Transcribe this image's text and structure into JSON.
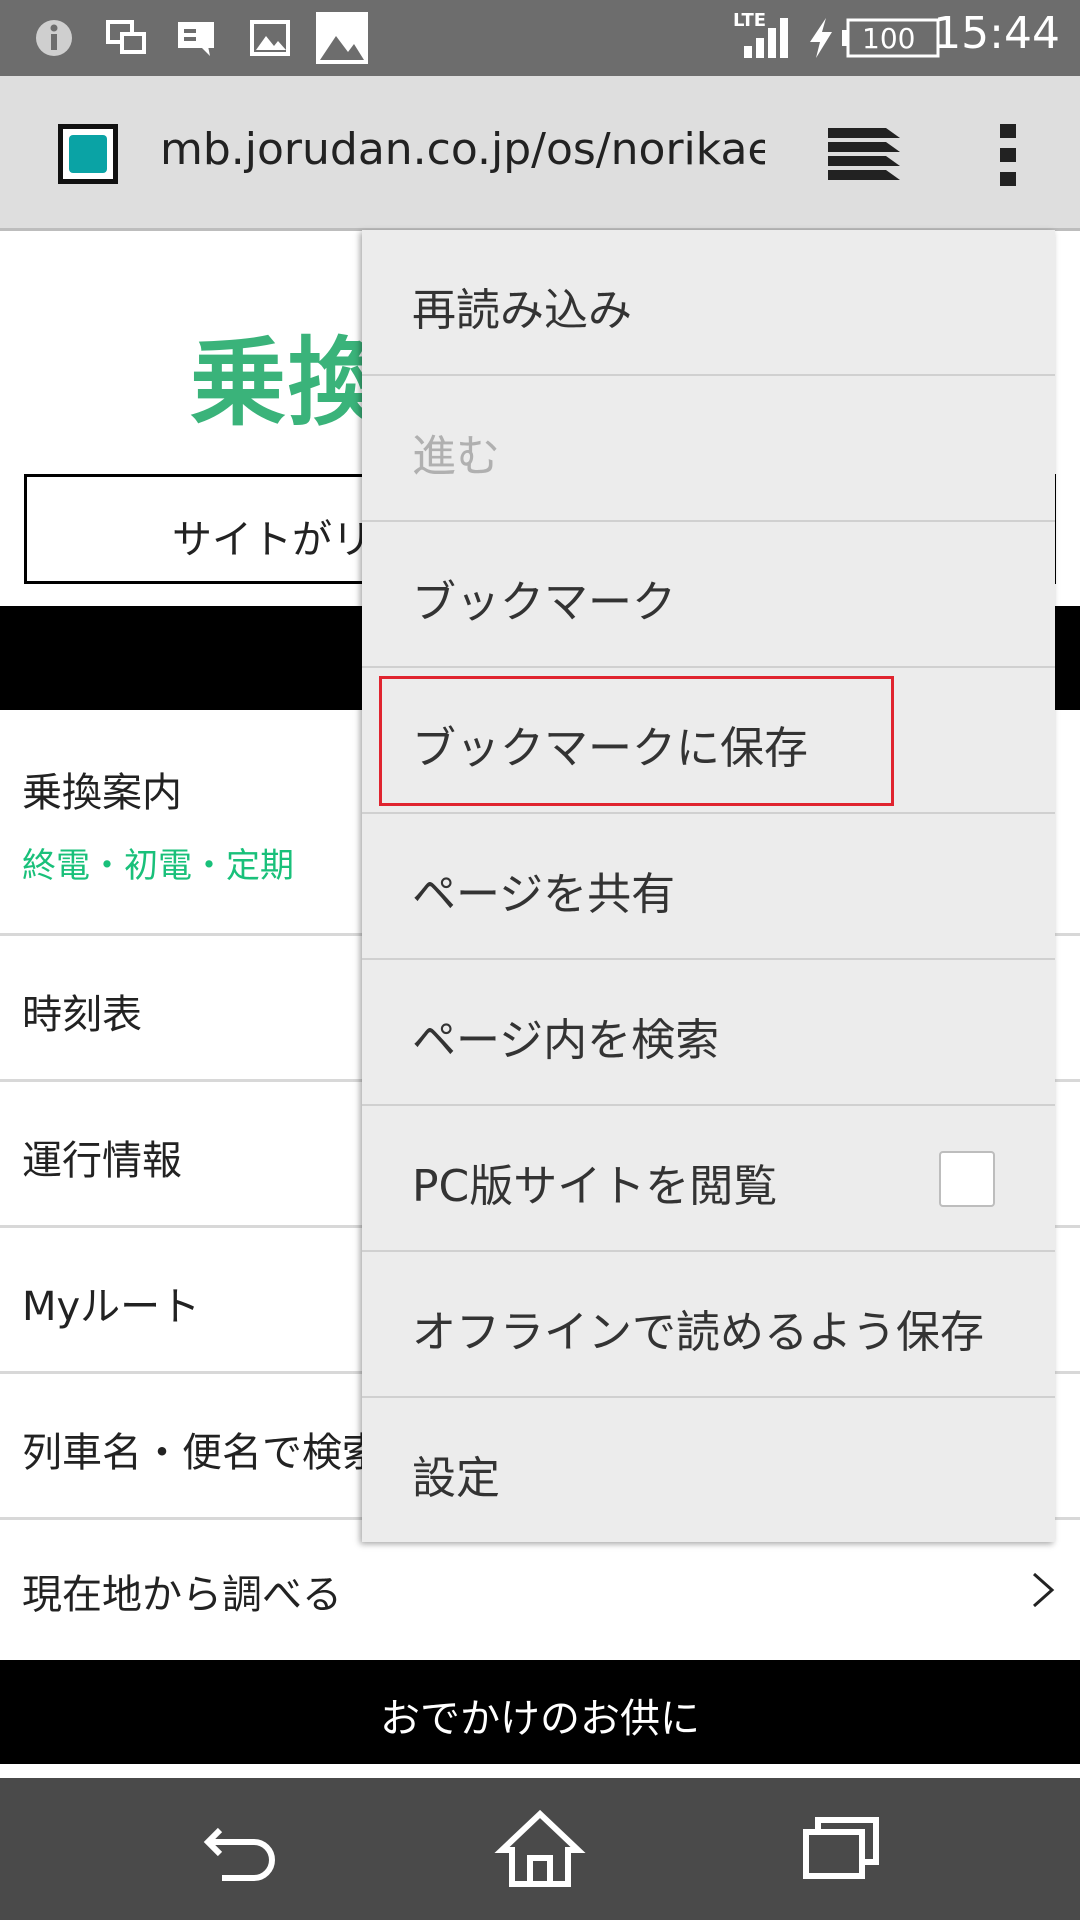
{
  "status_bar": {
    "time": "15:44",
    "network": "LTE",
    "battery": "100",
    "icons": [
      "info-icon",
      "screen-mirror-icon",
      "message-icon",
      "image-icon",
      "gallery-icon",
      "signal-icon",
      "charging-icon",
      "battery-icon"
    ]
  },
  "browser": {
    "url": "mb.jorudan.co.jp/os/norikae.c",
    "favicon": "train-favicon",
    "tabs_icon": "tabs-icon",
    "menu_icon": "overflow-menu-icon"
  },
  "page": {
    "logo_text": "乗換",
    "site_box_text": "サイトがリ",
    "list": [
      {
        "label": "乗換案内",
        "sub": "終電・初電・定期"
      },
      {
        "label": "時刻表"
      },
      {
        "label": "運行情報"
      },
      {
        "label": "Myルート"
      },
      {
        "label": "列車名・便名で検索"
      },
      {
        "label": "現在地から調べる"
      }
    ],
    "bottom_band_text": "おでかけのお供に",
    "accent_green": "#19c07a"
  },
  "menu": {
    "items": [
      {
        "label": "再読み込み"
      },
      {
        "label": "進む",
        "disabled": true
      },
      {
        "label": "ブックマーク"
      },
      {
        "label": "ブックマークに保存",
        "highlighted": true
      },
      {
        "label": "ページを共有"
      },
      {
        "label": "ページ内を検索"
      },
      {
        "label": "PC版サイトを閲覧",
        "checkbox": false
      },
      {
        "label": "オフラインで読めるよう保存"
      },
      {
        "label": "設定"
      }
    ],
    "highlight_color": "#e0242f"
  },
  "nav_bar": {
    "icons": [
      "back-icon",
      "home-icon",
      "recents-icon"
    ]
  }
}
